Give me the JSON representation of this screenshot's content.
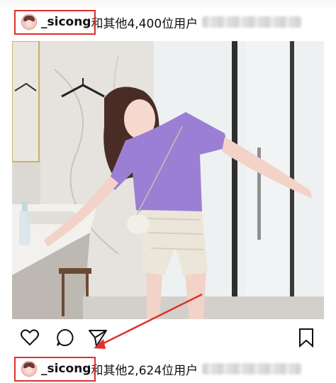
{
  "post_top": {
    "username": "_sicong",
    "likes_text": "和其他4,400位用户"
  },
  "post_bottom": {
    "username": "_sicong",
    "likes_text": "和其他2,624位用户"
  },
  "actions": {
    "like_icon": "heart-icon",
    "comment_icon": "comment-icon",
    "share_icon": "send-icon",
    "save_icon": "bookmark-icon"
  },
  "colors": {
    "highlight": "#e0302b",
    "shirt": "#9b7fd4"
  }
}
